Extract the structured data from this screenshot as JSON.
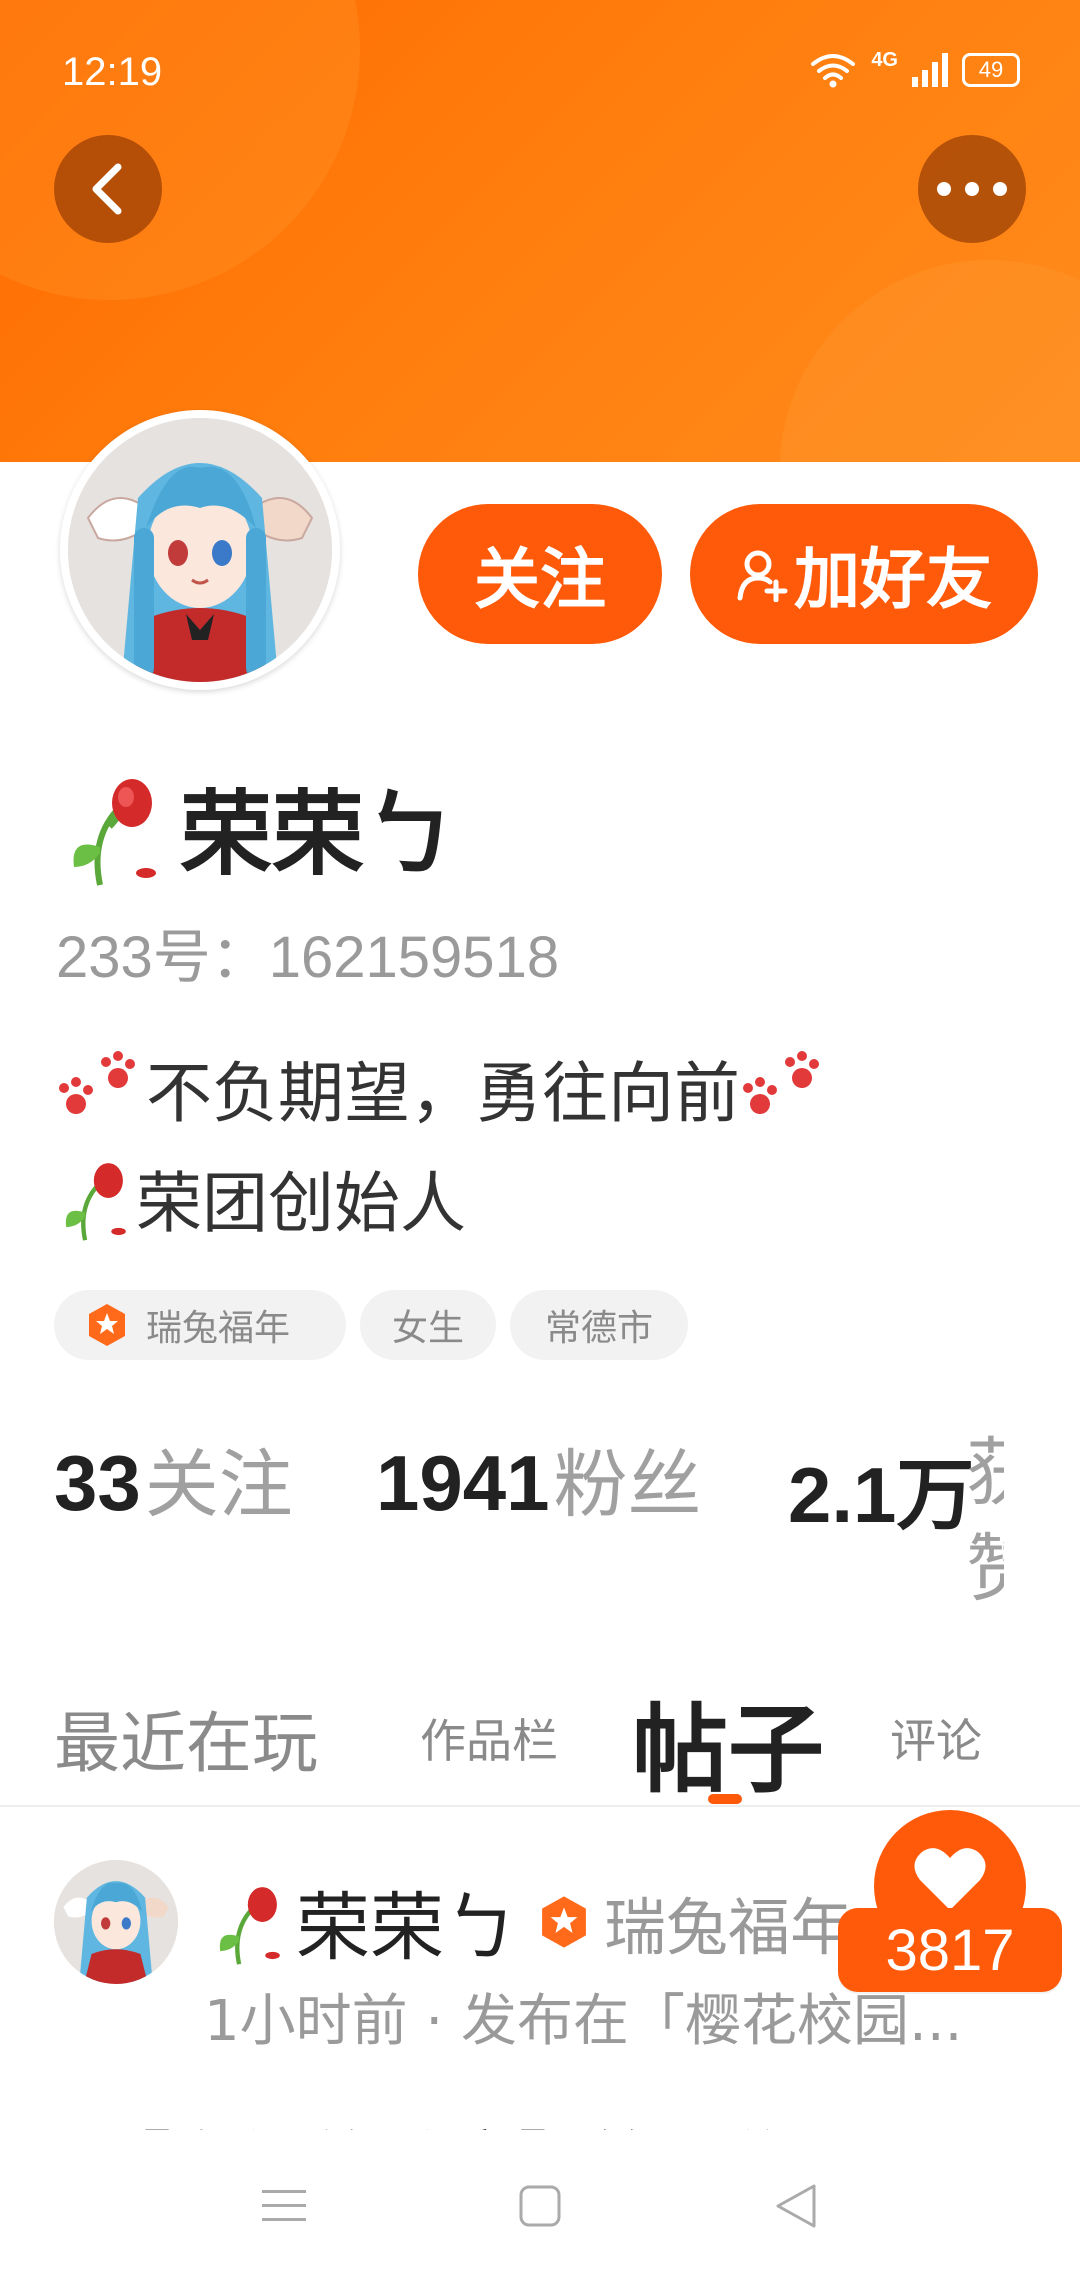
{
  "status_bar": {
    "time": "12:19",
    "network": "4G",
    "battery": "49"
  },
  "profile": {
    "name": "荣荣ㄅ",
    "id_line": "233号：162159518",
    "bio_line1": "不负期望，勇往向前",
    "bio_line2": "荣团创始人",
    "tags": [
      "瑞兔福年",
      "女生",
      "常德市"
    ]
  },
  "actions": {
    "follow": "关注",
    "add_friend": "加好友"
  },
  "stats": [
    {
      "num": "33",
      "label": "关注"
    },
    {
      "num": "1941",
      "label": "粉丝"
    },
    {
      "num": "2.1万",
      "label": "获赞"
    }
  ],
  "tabs": [
    "最近在玩",
    "作品栏",
    "帖子",
    "评论"
  ],
  "post": {
    "author": "荣荣ㄅ",
    "badge": "瑞兔福年",
    "meta": "1小时前 · 发布在「樱花校园...",
    "title": "【鬼微的暗恋】第一集",
    "likes": "3817"
  },
  "colors": {
    "accent": "#ff5a0a",
    "banner": "#ff7a0a",
    "muted": "#9a9a9a"
  }
}
